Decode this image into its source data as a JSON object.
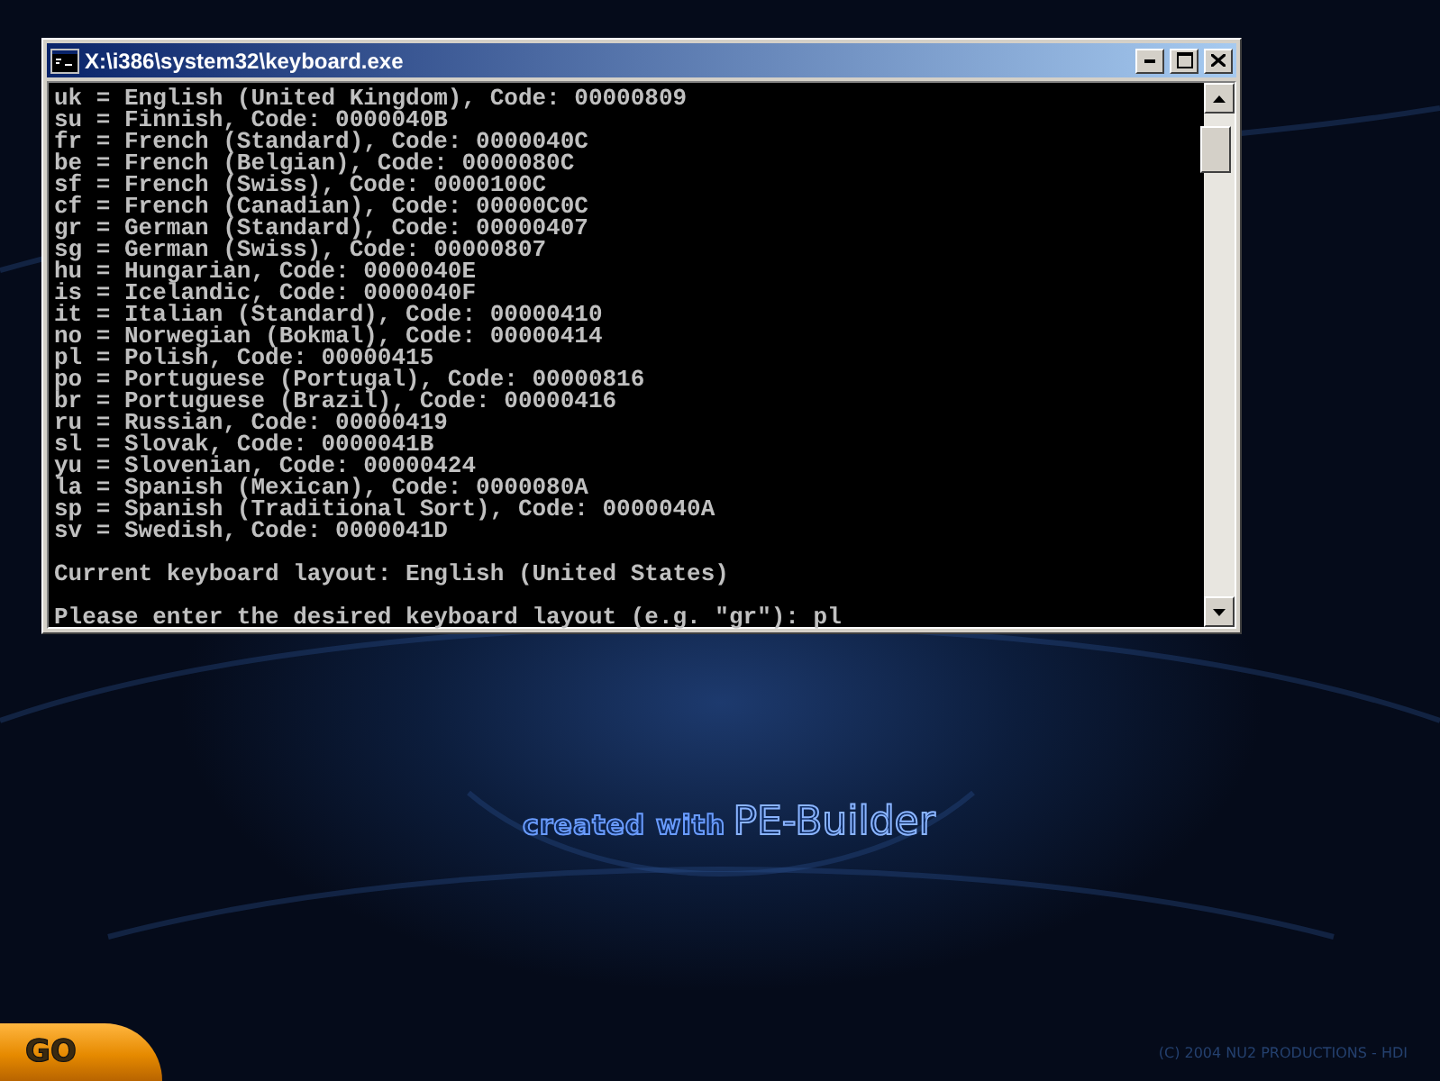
{
  "window": {
    "title": "X:\\i386\\system32\\keyboard.exe",
    "layouts": [
      "uk = English (United Kingdom), Code: 00000809",
      "su = Finnish, Code: 0000040B",
      "fr = French (Standard), Code: 0000040C",
      "be = French (Belgian), Code: 0000080C",
      "sf = French (Swiss), Code: 0000100C",
      "cf = French (Canadian), Code: 00000C0C",
      "gr = German (Standard), Code: 00000407",
      "sg = German (Swiss), Code: 00000807",
      "hu = Hungarian, Code: 0000040E",
      "is = Icelandic, Code: 0000040F",
      "it = Italian (Standard), Code: 00000410",
      "no = Norwegian (Bokmal), Code: 00000414",
      "pl = Polish, Code: 00000415",
      "po = Portuguese (Portugal), Code: 00000816",
      "br = Portuguese (Brazil), Code: 00000416",
      "ru = Russian, Code: 00000419",
      "sl = Slovak, Code: 0000041B",
      "yu = Slovenian, Code: 00000424",
      "la = Spanish (Mexican), Code: 0000080A",
      "sp = Spanish (Traditional Sort), Code: 0000040A",
      "sv = Swedish, Code: 0000041D"
    ],
    "current_layout": "Current keyboard layout: English (United States)",
    "prompt": "Please enter the desired keyboard layout (e.g. \"gr\"): ",
    "input": "pl"
  },
  "desktop": {
    "wordmark_prefix": "created with",
    "wordmark_name": "PE-Builder",
    "start_button": "GO",
    "copyright": "(C) 2004 NU2 PRODUCTIONS - HDI"
  }
}
